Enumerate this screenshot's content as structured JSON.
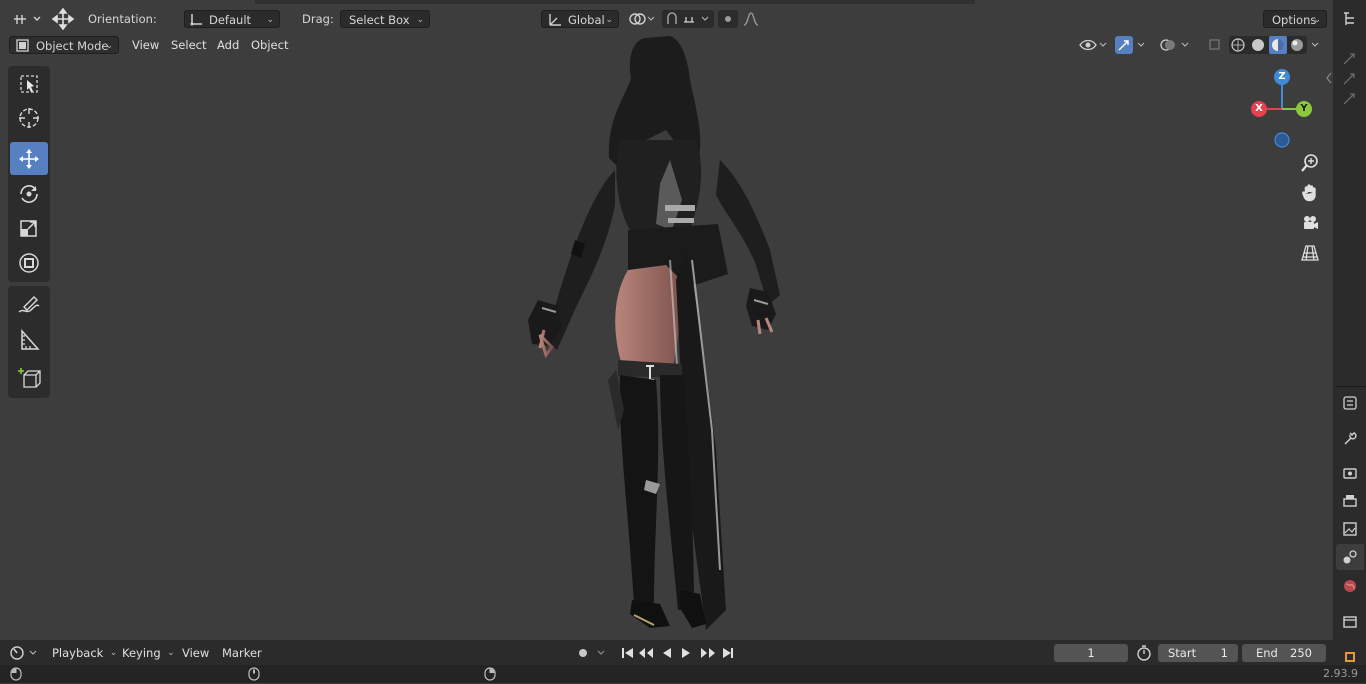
{
  "header": {
    "orientation_label": "Orientation:",
    "orientation_value": "Default",
    "drag_label": "Drag:",
    "drag_value": "Select Box",
    "transform_space": "Global",
    "options_label": "Options"
  },
  "viewport_header": {
    "mode": "Object Mode",
    "menus": [
      "View",
      "Select",
      "Add",
      "Object"
    ]
  },
  "toolbar": {
    "tools": [
      "select-box-icon",
      "cursor-icon",
      "move-icon",
      "rotate-icon",
      "scale-icon",
      "transform-icon",
      "annotate-icon",
      "measure-icon",
      "add-cube-icon"
    ],
    "active_tool": "move-icon"
  },
  "gizmo": {
    "axes": [
      "Z",
      "Y",
      "X"
    ],
    "colors": {
      "x": "#e8404f",
      "y": "#8bc93b",
      "z": "#3f8bd8"
    }
  },
  "timeline": {
    "menus": [
      "Playback",
      "Keying",
      "View",
      "Marker"
    ],
    "current_frame": "1",
    "start_label": "Start",
    "start_value": "1",
    "end_label": "End",
    "end_value": "250"
  },
  "status": {
    "version": "2.93.9"
  },
  "colors": {
    "accent": "#5680c2",
    "viewport_bg": "#3d3d3d",
    "panel_bg": "#2b2b2b"
  }
}
